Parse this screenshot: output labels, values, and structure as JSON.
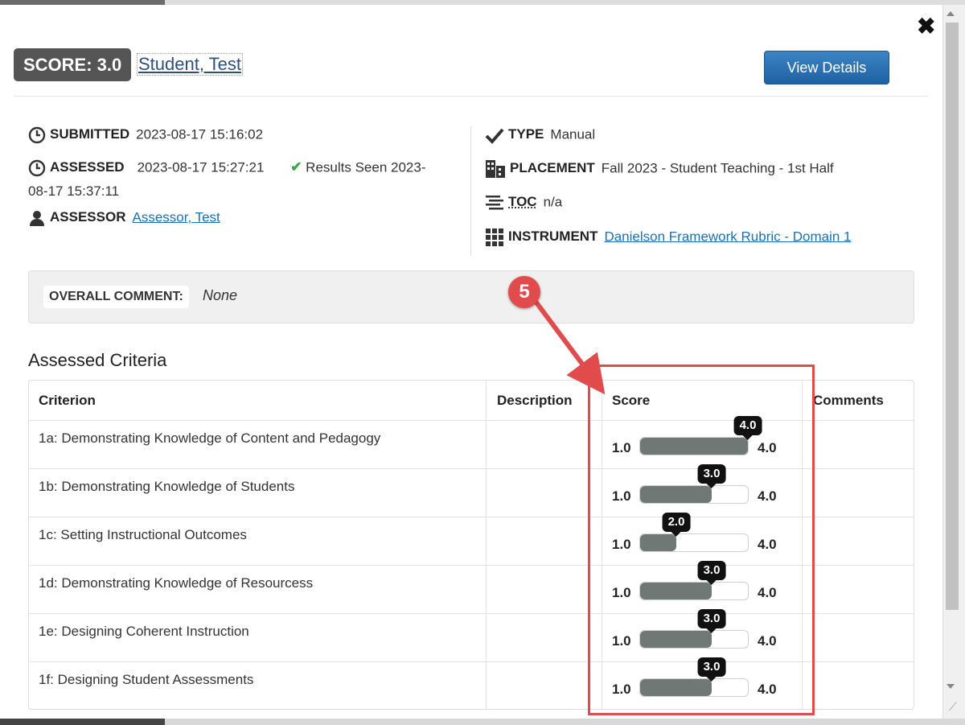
{
  "modal": {
    "score_label": "SCORE: 3.0",
    "student_name": "Student, Test",
    "view_details": "View Details",
    "close": "✖"
  },
  "meta": {
    "submitted_label": "SUBMITTED",
    "submitted_value": "2023-08-17 15:16:02",
    "assessed_label": "ASSESSED",
    "assessed_value": "2023-08-17 15:27:21",
    "results_seen_line1": "Results Seen 2023-",
    "results_seen_line2": "08-17 15:37:11",
    "assessor_label": "ASSESSOR",
    "assessor_value": "Assessor, Test",
    "type_label": "TYPE",
    "type_value": "Manual",
    "placement_label": "PLACEMENT",
    "placement_value": "Fall 2023 - Student Teaching - 1st Half",
    "toc_label": "TOC",
    "toc_value": "n/a",
    "instrument_label": "INSTRUMENT",
    "instrument_value": "Danielson Framework Rubric - Domain 1"
  },
  "comment": {
    "label": "OVERALL COMMENT:",
    "value": "None"
  },
  "section_title": "Assessed Criteria",
  "table": {
    "headers": [
      "Criterion",
      "Description",
      "Score",
      "Comments"
    ],
    "min_label": "1.0",
    "max_label": "4.0",
    "scale_min": 1.0,
    "scale_max": 4.0,
    "rows": [
      {
        "criterion": "1a: Demonstrating Knowledge of Content and Pedagogy",
        "score": 4.0,
        "score_label": "4.0"
      },
      {
        "criterion": "1b: Demonstrating Knowledge of Students",
        "score": 3.0,
        "score_label": "3.0"
      },
      {
        "criterion": "1c: Setting Instructional Outcomes",
        "score": 2.0,
        "score_label": "2.0"
      },
      {
        "criterion": "1d: Demonstrating Knowledge of Resourcess",
        "score": 3.0,
        "score_label": "3.0"
      },
      {
        "criterion": "1e: Designing Coherent Instruction",
        "score": 3.0,
        "score_label": "3.0"
      },
      {
        "criterion": "1f: Designing Student Assessments",
        "score": 3.0,
        "score_label": "3.0"
      }
    ]
  },
  "annotation": {
    "step": "5",
    "color": "#e24b4b"
  },
  "colors": {
    "fill": "#707876",
    "link": "#1e6fb5",
    "button": "#1f62a3"
  }
}
